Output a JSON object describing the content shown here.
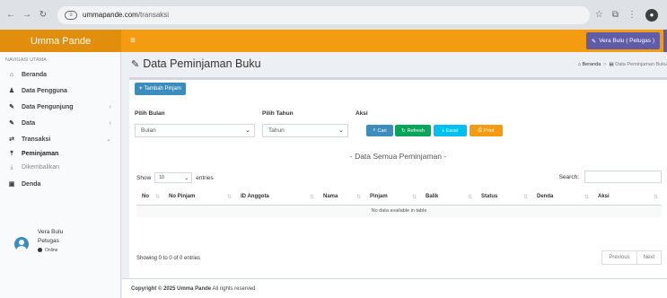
{
  "browser": {
    "url_host": "ummapande.com",
    "url_path": "/transaksi"
  },
  "header": {
    "logo": "Umma Pande",
    "hamburger": "≡",
    "user_button": "Vera Bulu ( Petugas )"
  },
  "sidebar": {
    "section_header": "NAVIGASI UTAMA",
    "items": [
      {
        "label": "Beranda"
      },
      {
        "label": "Data Pengguna"
      },
      {
        "label": "Data Pengunjung"
      },
      {
        "label": "Data"
      },
      {
        "label": "Transaksi"
      }
    ],
    "sub_items": [
      {
        "label": "Peminjaman"
      },
      {
        "label": "Dikembalikan"
      }
    ],
    "denda": "Denda",
    "user": {
      "name": "Vera Bulu",
      "role": "Petugas",
      "status": "Online"
    }
  },
  "page": {
    "title": "Data Peminjaman Buku",
    "breadcrumb_home": "Beranda",
    "breadcrumb_current": "Data Peminjaman Buku"
  },
  "box": {
    "add_button": "Tambah Pinjam",
    "filter_month_label": "Pilih Bulan",
    "filter_year_label": "Pilih Tahun",
    "action_label": "Aksi",
    "month_select": "Bulan",
    "year_select": "Tahun",
    "buttons": {
      "cari": "Cari",
      "refresh": "Refresh",
      "excel": "Excel",
      "print": "Print"
    },
    "section_title": "- Data Semua Peminjaman -",
    "show_label": "Show",
    "show_value": "10",
    "entries_label": "entries",
    "search_label": "Search:",
    "columns": [
      "No",
      "No Pinjam",
      "ID Anggota",
      "Nama",
      "Pinjam",
      "Balik",
      "Status",
      "Denda",
      "Aksi"
    ],
    "empty_message": "No data available in table",
    "info": "Showing 0 to 0 of 0 entries",
    "prev": "Previous",
    "next": "Next"
  },
  "footer": {
    "prefix": "Copyright © 2025",
    "brand": "Umma Pande",
    "suffix": "All rights reserved"
  },
  "colors": {
    "header": "#f39c12",
    "logo_bg": "#e08e0b",
    "user_button": "#605ca8",
    "primary": "#3c8dbc",
    "success": "#00a65a",
    "info": "#00c0ef",
    "warning": "#f39c12"
  }
}
